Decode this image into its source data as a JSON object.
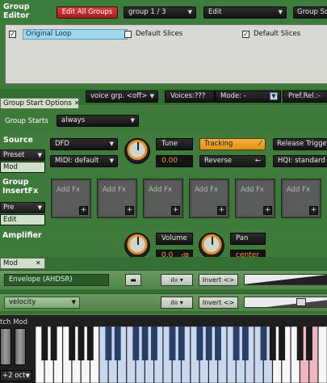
{
  "group_editor": {
    "title_line1": "Group",
    "title_line2": "Editor",
    "edit_all_groups": "Edit All Groups",
    "group_selector": "group 1 / 3",
    "edit_menu": "Edit",
    "group_solo": "Group So",
    "group_name": "Original Loop",
    "slice_option_1": "Default Slices",
    "slice_option_2": "Default Slices"
  },
  "voice_strip": {
    "voice_group": "voice grp. <off>",
    "voices": "Voices:???",
    "mode": "Mode: -",
    "pref_rel": "Pref.Rel.:-"
  },
  "group_start": {
    "tab_label": "Group Start Options",
    "label": "Group Starts",
    "value": "always"
  },
  "source": {
    "title": "Source",
    "preset": "Preset",
    "mod": "Mod",
    "engine": "DFD",
    "midi": "MIDI: default",
    "tune_label": "Tune",
    "tune_value": "0.00",
    "tracking": "Tracking",
    "reverse": "Reverse",
    "release_trigger": "Release Trigge",
    "hqi": "HQI: standard"
  },
  "insert_fx": {
    "title_line1": "Group",
    "title_line2": "InsertFx",
    "pre": "Pre",
    "edit": "Edit",
    "slots": [
      {
        "label": "Add Fx",
        "add": "+"
      },
      {
        "label": "Add Fx",
        "add": "+"
      },
      {
        "label": "Add Fx",
        "add": "+"
      },
      {
        "label": "Add Fx",
        "add": "+"
      },
      {
        "label": "Add Fx",
        "add": "+"
      },
      {
        "label": "Add Fx",
        "add": "+"
      }
    ]
  },
  "amplifier": {
    "title": "Amplifier",
    "volume_label": "Volume",
    "volume_value": "0.0",
    "volume_unit": "dB",
    "pan_label": "Pan",
    "pan_value": "center"
  },
  "mod": {
    "tab_label": "Mod",
    "rows": [
      {
        "source": "Envelope (AHDSR)",
        "invert": "Invert <>"
      },
      {
        "source": "velocity",
        "invert": "Invert <>"
      }
    ]
  },
  "keyboard": {
    "label": "tch Mod",
    "octave": "+2 oct"
  },
  "colors": {
    "panel_green": "#3d7d3b",
    "accent_orange": "#e48f16",
    "edit_all_red": "#c0262b",
    "selection_blue": "#9fd8ea"
  }
}
